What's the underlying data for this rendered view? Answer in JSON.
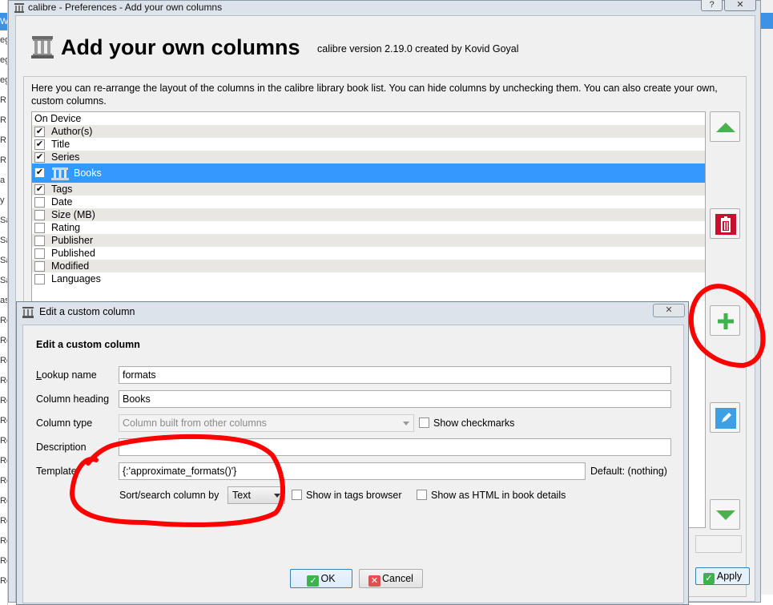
{
  "window": {
    "title": "calibre - Preferences - Add your own columns",
    "help_label": "?",
    "close_label": "✕"
  },
  "header": {
    "title": "Add your own columns",
    "version": "calibre version 2.19.0 created by Kovid Goyal"
  },
  "description": "Here you can re-arrange the layout of the columns in the calibre library book list. You can hide columns by unchecking them. You can also create your own, custom columns.",
  "columns": [
    {
      "label": "On Device",
      "checkbox": false,
      "checked": false
    },
    {
      "label": "Author(s)",
      "checkbox": true,
      "checked": true
    },
    {
      "label": "Title",
      "checkbox": true,
      "checked": true
    },
    {
      "label": "Series",
      "checkbox": true,
      "checked": true
    },
    {
      "label": "Books",
      "checkbox": true,
      "checked": true,
      "selected": true,
      "icon": "calibre-library-icon"
    },
    {
      "label": "Tags",
      "checkbox": true,
      "checked": true
    },
    {
      "label": "Date",
      "checkbox": true,
      "checked": false
    },
    {
      "label": "Size (MB)",
      "checkbox": true,
      "checked": false
    },
    {
      "label": "Rating",
      "checkbox": true,
      "checked": false
    },
    {
      "label": "Publisher",
      "checkbox": true,
      "checked": false
    },
    {
      "label": "Published",
      "checkbox": true,
      "checked": false
    },
    {
      "label": "Modified",
      "checkbox": true,
      "checked": false
    },
    {
      "label": "Languages",
      "checkbox": true,
      "checked": false
    }
  ],
  "side_buttons": {
    "move_up": "arrow-up-icon",
    "delete": "trash-icon",
    "add": "plus-icon",
    "edit": "pencil-icon",
    "move_down": "arrow-down-icon"
  },
  "apply_label": "Apply",
  "dialog": {
    "title": "Edit a custom column",
    "close_label": "✕",
    "heading": "Edit a custom column",
    "lookup_name": {
      "label": "Lookup name",
      "value": "formats"
    },
    "column_heading": {
      "label": "Column heading",
      "value": "Books"
    },
    "column_type": {
      "label": "Column type",
      "value": "Column built from other columns",
      "show_checkmarks": "Show checkmarks"
    },
    "description": {
      "label": "Description",
      "value": ""
    },
    "template": {
      "label": "Template",
      "value": "{:'approximate_formats()'}",
      "default_text": "Default: (nothing)"
    },
    "sort_by": {
      "label": "Sort/search column by",
      "value": "Text"
    },
    "show_in_tags_browser": "Show in tags browser",
    "show_as_html": "Show as HTML in book details",
    "ok_label": "OK",
    "cancel_label": "Cancel"
  },
  "colors": {
    "selection": "#3399ff",
    "delete_button": "#c8102e",
    "add_green": "#3cb44b",
    "edit_blue": "#3ca0e6",
    "annotation_red": "#ff0000"
  }
}
